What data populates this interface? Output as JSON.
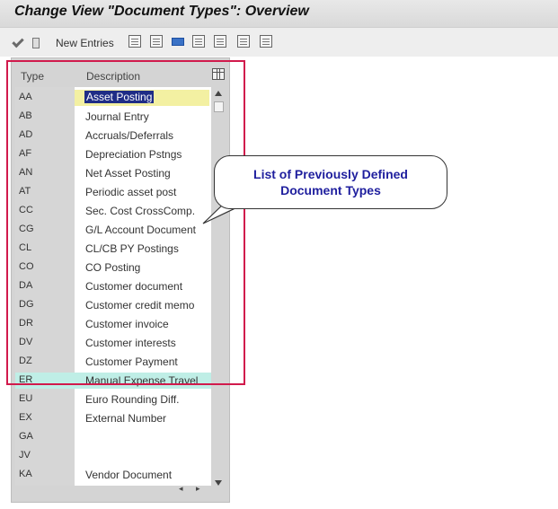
{
  "window": {
    "title": "Change View \"Document Types\": Overview"
  },
  "toolbar": {
    "new_entries_label": "New Entries",
    "icons": [
      "check-icon",
      "details-icon",
      "copy-icon",
      "delete-icon",
      "select-all-icon",
      "select-block-icon",
      "deselect-all-icon",
      "print-icon",
      "configure-icon"
    ]
  },
  "table": {
    "headers": {
      "type": "Type",
      "description": "Description"
    },
    "rows": [
      {
        "type": "AA",
        "description": "Asset Posting"
      },
      {
        "type": "AB",
        "description": "Journal Entry"
      },
      {
        "type": "AD",
        "description": "Accruals/Deferrals"
      },
      {
        "type": "AF",
        "description": "Depreciation Pstngs"
      },
      {
        "type": "AN",
        "description": "Net Asset Posting"
      },
      {
        "type": "AT",
        "description": "Periodic asset post"
      },
      {
        "type": "CC",
        "description": "Sec. Cost CrossComp."
      },
      {
        "type": "CG",
        "description": "G/L Account Document"
      },
      {
        "type": "CL",
        "description": "CL/CB PY Postings"
      },
      {
        "type": "CO",
        "description": "CO Posting"
      },
      {
        "type": "DA",
        "description": "Customer document"
      },
      {
        "type": "DG",
        "description": "Customer credit memo"
      },
      {
        "type": "DR",
        "description": "Customer invoice"
      },
      {
        "type": "DV",
        "description": "Customer interests"
      },
      {
        "type": "DZ",
        "description": "Customer Payment"
      },
      {
        "type": "ER",
        "description": "Manual Expense Travel"
      },
      {
        "type": "EU",
        "description": "Euro Rounding Diff."
      },
      {
        "type": "EX",
        "description": "External Number"
      },
      {
        "type": "GA",
        "description": ""
      },
      {
        "type": "JV",
        "description": ""
      },
      {
        "type": "KA",
        "description": "Vendor Document"
      }
    ],
    "selected_index": 0,
    "highlighted_index": 15
  },
  "callout": {
    "line1": "List of Previously Defined",
    "line2": "Document Types"
  },
  "colors": {
    "frame": "#d11a4c",
    "callout_text": "#1f1f9e",
    "selection_bg": "#1f2d86",
    "selection_field": "#f3f0a2",
    "highlight_row": "#bfeee6"
  }
}
